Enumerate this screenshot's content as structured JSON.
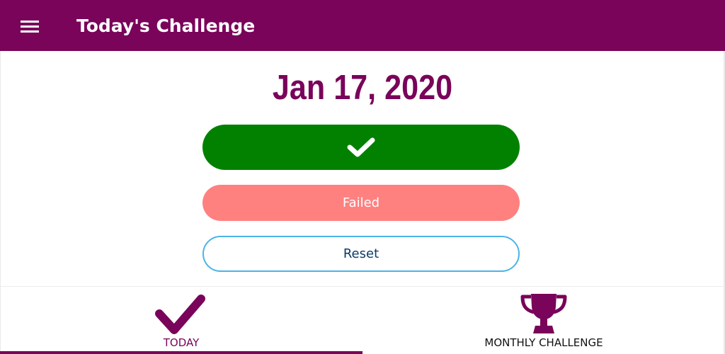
{
  "app_bar": {
    "title": "Today's Challenge",
    "menu_icon": "hamburger-menu-icon",
    "background_color": "#79045a"
  },
  "main": {
    "date": "Jan 17, 2020",
    "success_button": {
      "icon": "checkmark-icon",
      "color": "#028101"
    },
    "failed_button": {
      "label": "Failed",
      "color": "#fe8180"
    },
    "reset_button": {
      "label": "Reset",
      "border_color": "#4db3e6"
    }
  },
  "bottom_nav": {
    "tabs": [
      {
        "label": "TODAY",
        "icon": "checkmark-icon",
        "selected": true
      },
      {
        "label": "MONTHLY CHALLENGE",
        "icon": "trophy-icon",
        "selected": false
      }
    ],
    "accent_color": "#79045a"
  }
}
